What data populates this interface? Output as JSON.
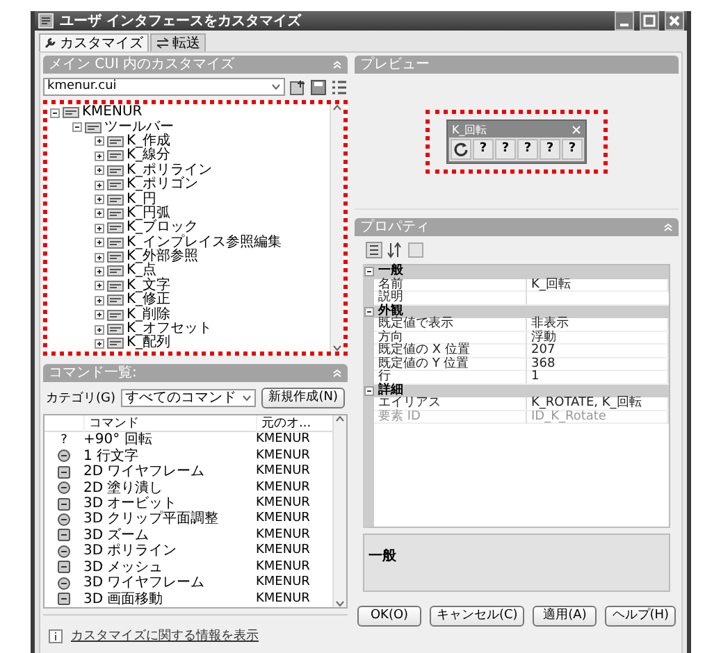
{
  "window": {
    "title": "ユーザ インタフェースをカスタマイズ"
  },
  "tabs": [
    {
      "label": "カスタマイズ",
      "selected": true
    },
    {
      "label": "転送",
      "selected": false
    }
  ],
  "customize_panel": {
    "title": "メイン CUI 内のカスタマイズ",
    "file": "kmenur.cui",
    "tree": [
      {
        "label": "KMENUR",
        "expanded": true,
        "children": [
          {
            "label": "ツールバー",
            "expanded": true,
            "children": [
              {
                "label": "K_作成",
                "expanded": false
              },
              {
                "label": "K_線分",
                "expanded": false
              },
              {
                "label": "K_ポリライン",
                "expanded": false
              },
              {
                "label": "K_ポリゴン",
                "expanded": false
              },
              {
                "label": "K_円",
                "expanded": false
              },
              {
                "label": "K_円弧",
                "expanded": false
              },
              {
                "label": "K_ブロック",
                "expanded": false
              },
              {
                "label": "K_インプレイス参照編集",
                "expanded": false
              },
              {
                "label": "K_外部参照",
                "expanded": false
              },
              {
                "label": "K_点",
                "expanded": false
              },
              {
                "label": "K_文字",
                "expanded": false
              },
              {
                "label": "K_修正",
                "expanded": false
              },
              {
                "label": "K_削除",
                "expanded": false
              },
              {
                "label": "K_オフセット",
                "expanded": false
              },
              {
                "label": "K_配列",
                "expanded": false
              }
            ]
          }
        ]
      }
    ]
  },
  "command_list": {
    "title": "コマンド一覧:",
    "category_label": "カテゴリ(G)",
    "category": "すべてのコマンド",
    "new_button": "新規作成(N)",
    "columns": [
      "コマンド",
      "元のオ..."
    ],
    "rows": [
      {
        "glyph": "?",
        "name": "+90° 回転",
        "source": "KMENUR"
      },
      {
        "name": "1 行文字",
        "source": "KMENUR"
      },
      {
        "name": "2D ワイヤフレーム",
        "source": "KMENUR"
      },
      {
        "name": "2D 塗り潰し",
        "source": "KMENUR"
      },
      {
        "name": "3D オービット",
        "source": "KMENUR"
      },
      {
        "name": "3D クリップ平面調整",
        "source": "KMENUR"
      },
      {
        "name": "3D ズーム",
        "source": "KMENUR"
      },
      {
        "name": "3D ポリライン",
        "source": "KMENUR"
      },
      {
        "name": "3D メッシュ",
        "source": "KMENUR"
      },
      {
        "name": "3D ワイヤフレーム",
        "source": "KMENUR"
      },
      {
        "name": "3D 画面移動",
        "source": "KMENUR"
      }
    ]
  },
  "info_link": "カスタマイズに関する情報を表示",
  "preview": {
    "title": "プレビュー",
    "toolbar": {
      "title": "K_回転",
      "buttons": [
        {
          "kind": "icon"
        },
        {
          "kind": "text",
          "label": "?"
        },
        {
          "kind": "text",
          "label": "?"
        },
        {
          "kind": "text",
          "label": "?"
        },
        {
          "kind": "text",
          "label": "?"
        },
        {
          "kind": "text",
          "label": "?"
        }
      ]
    }
  },
  "properties": {
    "title": "プロパティ",
    "categories": [
      {
        "name": "一般",
        "expanded": true,
        "rows": [
          {
            "name": "名前",
            "value": "K_回転",
            "disabled": false
          },
          {
            "name": "説明",
            "disabled": false
          }
        ]
      },
      {
        "name": "外観",
        "expanded": true,
        "rows": [
          {
            "name": "既定値で表示",
            "value": "非表示",
            "disabled": false
          },
          {
            "name": "方向",
            "value": "浮動",
            "disabled": false
          },
          {
            "name": "既定値の X 位置",
            "value": "207",
            "disabled": false
          },
          {
            "name": "既定値の Y 位置",
            "value": "368",
            "disabled": false
          },
          {
            "name": "行",
            "value": "1",
            "disabled": false
          }
        ]
      },
      {
        "name": "詳細",
        "expanded": true,
        "rows": [
          {
            "name": "エイリアス",
            "value": "K_ROTATE, K_回転",
            "disabled": false
          },
          {
            "name": "要素 ID",
            "value": "ID_K_Rotate",
            "disabled": true
          }
        ]
      }
    ],
    "description": "一般"
  },
  "buttons": [
    "OK(O)",
    "キャンセル(C)",
    "適用(A)",
    "ヘルプ(H)"
  ]
}
